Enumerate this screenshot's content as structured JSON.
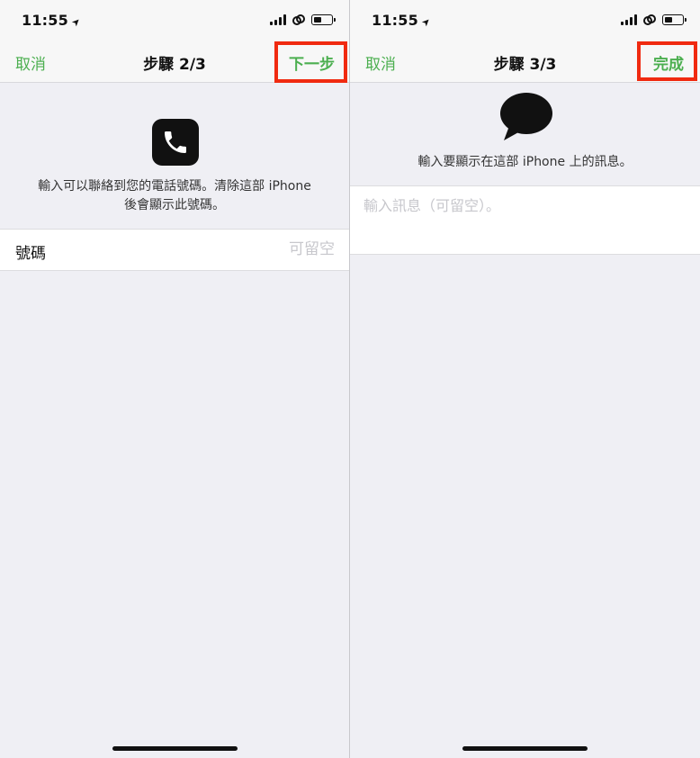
{
  "left": {
    "status": {
      "time": "11:55"
    },
    "nav": {
      "cancel": "取消",
      "title": "步驟 2/3",
      "next": "下一步"
    },
    "description_line1": "輸入可以聯絡到您的電話號碼。清除這部 iPhone",
    "description_line2": "後會顯示此號碼。",
    "field": {
      "label": "號碼",
      "placeholder": "可留空"
    }
  },
  "right": {
    "status": {
      "time": "11:55"
    },
    "nav": {
      "cancel": "取消",
      "title": "步驟 3/3",
      "done": "完成"
    },
    "description": "輸入要顯示在這部 iPhone 上的訊息。",
    "message": {
      "placeholder": "輸入訊息（可留空）。"
    }
  },
  "colors": {
    "accent": "#4caf50",
    "highlight": "#f02a10",
    "background": "#efeff4"
  },
  "icons": {
    "phone": "phone-icon",
    "bubble": "speech-bubble-icon",
    "location": "location-arrow-icon"
  }
}
